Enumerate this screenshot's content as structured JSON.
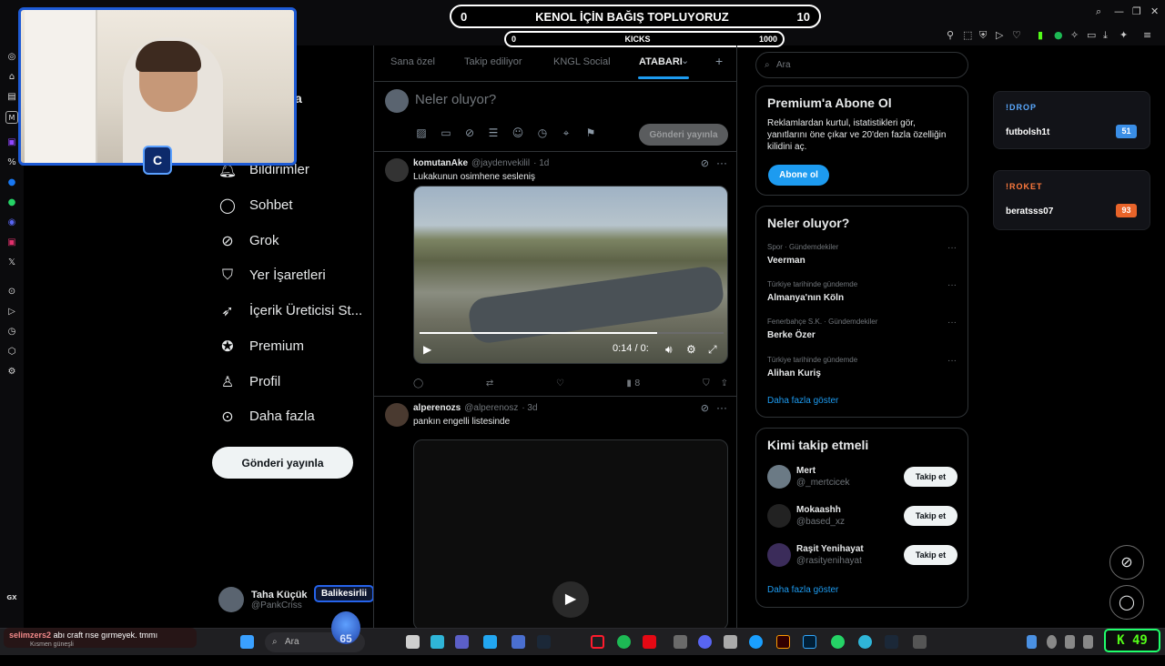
{
  "overlay": {
    "donation_left": "0",
    "donation_title": "KENOL İÇİN BAĞIŞ TOPLUYORUZ",
    "donation_right": "10",
    "kicks_left": "0",
    "kicks_title": "KICKS",
    "kicks_right": "1000",
    "cam_logo": "C",
    "gx_label": "GX",
    "kick_counter": "49",
    "emote_count": "65"
  },
  "nav": {
    "items": [
      {
        "label": "Bildirimler",
        "icon": "bell-icon"
      },
      {
        "label": "Sohbet",
        "icon": "chat-icon"
      },
      {
        "label": "Grok",
        "icon": "grok-icon"
      },
      {
        "label": "Yer İşaretleri",
        "icon": "bookmark-icon"
      },
      {
        "label": "İçerik Üreticisi St...",
        "icon": "rocket-icon"
      },
      {
        "label": "Premium",
        "icon": "verified-icon"
      },
      {
        "label": "Profil",
        "icon": "person-icon"
      },
      {
        "label": "Daha fazla",
        "icon": "more-circle-icon"
      }
    ],
    "post_button": "Gönderi yayınla",
    "partial_letter": "a"
  },
  "profile": {
    "name": "Taha Küçük",
    "handle": "@PankCriss",
    "badge": "Balikesirlii"
  },
  "tabs": [
    {
      "label": "Sana özel"
    },
    {
      "label": "Takip ediliyor"
    },
    {
      "label": "KNGL Social"
    },
    {
      "label": "ATABARI",
      "active": true
    }
  ],
  "tab_dropdown": "⌄",
  "tab_add": "+",
  "compose": {
    "placeholder": "Neler oluyor?",
    "button": "Gönderi yayınla"
  },
  "tweets": [
    {
      "name": "komutanAke",
      "handle": "@jaydenvekilil",
      "time": "· 1d",
      "text": "Lukakunun osimhene sesleniş",
      "video_time": "0:14 / 0:",
      "video_progress": 0.78,
      "views": "8"
    },
    {
      "name": "alperenozs",
      "handle": "@alperenosz",
      "time": "· 3d",
      "text": "pankın engelli listesinde"
    }
  ],
  "search": {
    "placeholder": "Ara"
  },
  "premium": {
    "title": "Premium'a Abone Ol",
    "body": "Reklamlardan kurtul, istatistikleri gör, yanıtlarını öne çıkar ve 20'den fazla özelliğin kilidini aç.",
    "button": "Abone ol"
  },
  "trends": {
    "title": "Neler oluyor?",
    "items": [
      {
        "context": "Spor · Gündemdekiler",
        "name": "Veerman"
      },
      {
        "context": "Türkiye tarihinde gündemde",
        "name": "Almanya'nın Köln"
      },
      {
        "context": "Fenerbahçe S.K. · Gündemdekiler",
        "name": "Berke Özer"
      },
      {
        "context": "Türkiye tarihinde gündemde",
        "name": "Alihan Kuriş"
      }
    ],
    "show_more": "Daha fazla göster",
    "more_glyph": "···"
  },
  "follow": {
    "title": "Kimi takip etmeli",
    "users": [
      {
        "name": "Mert",
        "handle": "@_mertcicek",
        "button": "Takip et"
      },
      {
        "name": "Mokaashh",
        "handle": "@based_xz",
        "button": "Takip et"
      },
      {
        "name": "Raşit Yenihayat",
        "handle": "@rasityenihayat",
        "button": "Takip et"
      }
    ],
    "show_more": "Daha fazla göster"
  },
  "widgets": [
    {
      "title": "!DROP",
      "user": "futbolsh1t",
      "count": "51",
      "color": "#5aa9ff",
      "badge_bg": "#3a8ee6"
    },
    {
      "title": "!ROKET",
      "user": "beratsss07",
      "count": "93",
      "color": "#ff7a3d",
      "badge_bg": "#e8642a"
    }
  ],
  "chat": {
    "user": "selimzers2",
    "message": "abı craft rıse gırmeyek. tmmı",
    "sub": "Kısmen güneşli"
  },
  "taskbar": {
    "search": "Ara"
  }
}
